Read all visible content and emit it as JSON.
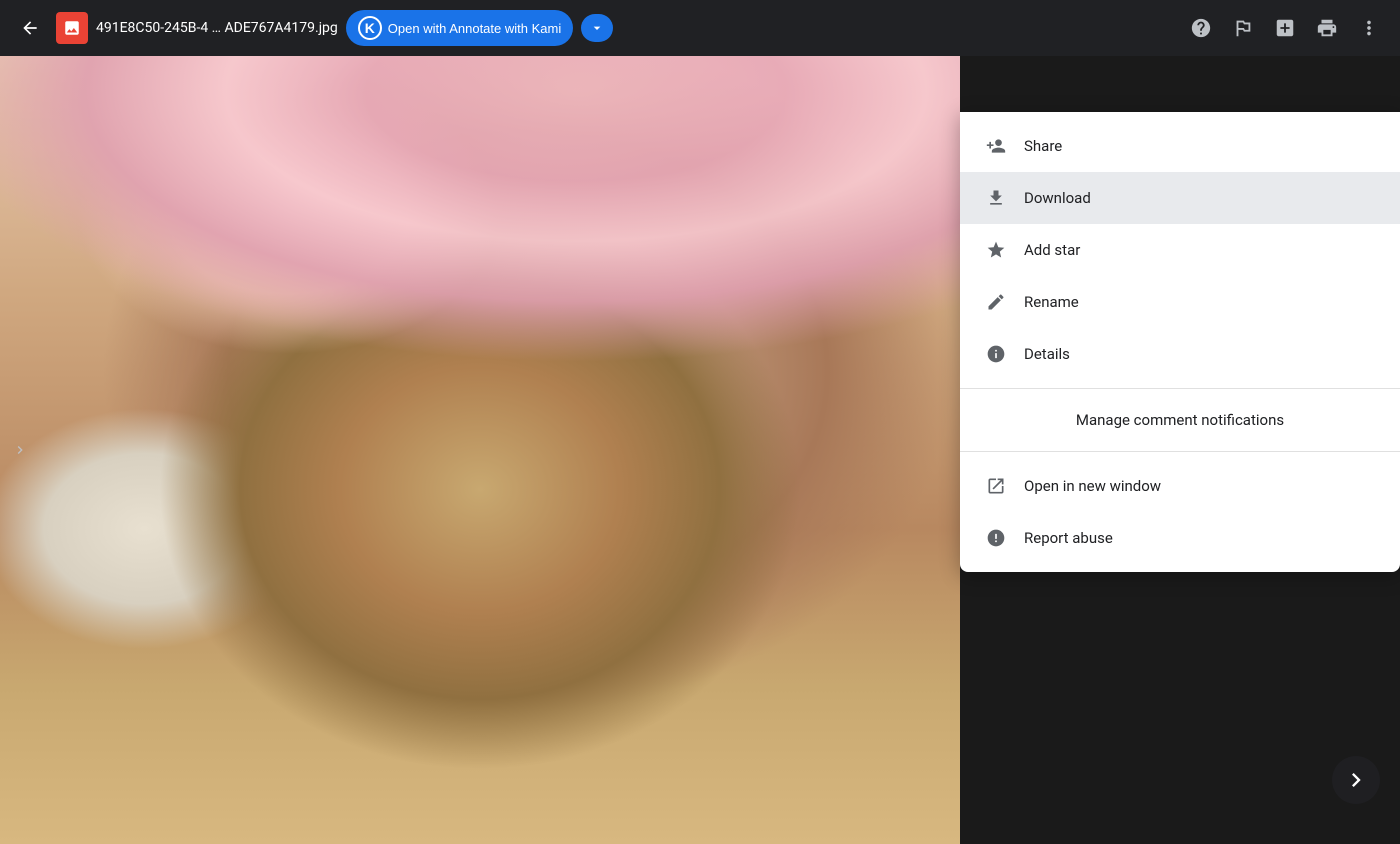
{
  "toolbar": {
    "back_label": "←",
    "file_icon_text": "▲",
    "file_title": "491E8C50-245B-4 … ADE767A4179.jpg",
    "open_with_label": "Open with Annotate with Kami",
    "kami_letter": "K",
    "dropdown_arrow": "▾"
  },
  "menu": {
    "items": [
      {
        "id": "share",
        "label": "Share",
        "icon": "person-add"
      },
      {
        "id": "download",
        "label": "Download",
        "icon": "download",
        "active": true
      },
      {
        "id": "add-star",
        "label": "Add star",
        "icon": "star"
      },
      {
        "id": "rename",
        "label": "Rename",
        "icon": "edit"
      },
      {
        "id": "details",
        "label": "Details",
        "icon": "info"
      }
    ],
    "manage_notifications": "Manage comment notifications",
    "open_new_window": "Open in new window",
    "report_abuse": "Report abuse"
  },
  "nav": {
    "next_label": "›"
  }
}
